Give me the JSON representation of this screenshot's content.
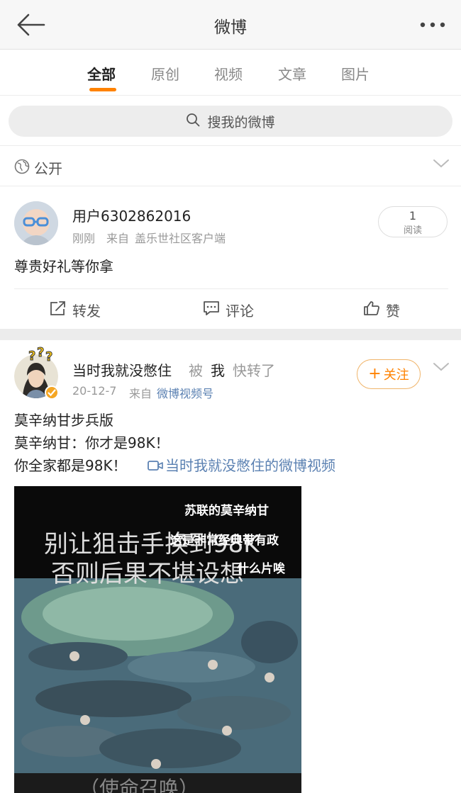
{
  "header": {
    "title": "微博"
  },
  "tabs": [
    {
      "label": "全部"
    },
    {
      "label": "原创"
    },
    {
      "label": "视频"
    },
    {
      "label": "文章"
    },
    {
      "label": "图片"
    }
  ],
  "search": {
    "placeholder": "搜我的微博"
  },
  "privacy": {
    "label": "公开"
  },
  "post1": {
    "user": "用户6302862016",
    "time": "刚刚",
    "source_prefix": "来自",
    "source": "盖乐世社区客户端",
    "read_count": "1",
    "read_label": "阅读",
    "text": "尊贵好礼等你拿",
    "actions": {
      "repost": "转发",
      "comment": "评论",
      "like": "赞"
    }
  },
  "post2": {
    "user": "当时我就没憋住",
    "by": "被",
    "me": "我",
    "quick_repost": "快转了",
    "follow_label": "关注",
    "date": "20-12-7",
    "source_prefix": "来自",
    "source": "微博视频号",
    "lines": [
      "莫辛纳甘步兵版",
      "莫辛纳甘：你才是98K！",
      "你全家都是98K！"
    ],
    "video_link": "当时我就没憋住的微博视频",
    "video": {
      "overlay_title": "苏联的莫辛纳甘",
      "caption1": "别让狙击手换到98K",
      "caption2": "否则后果不堪设想",
      "scroll1": "这是非常经典带有政",
      "scroll2": "什么片唉",
      "bottom": "（使命召唤）"
    }
  },
  "colors": {
    "accent": "#ff8200",
    "link": "#5b81b2",
    "badge": "#f5a623"
  }
}
